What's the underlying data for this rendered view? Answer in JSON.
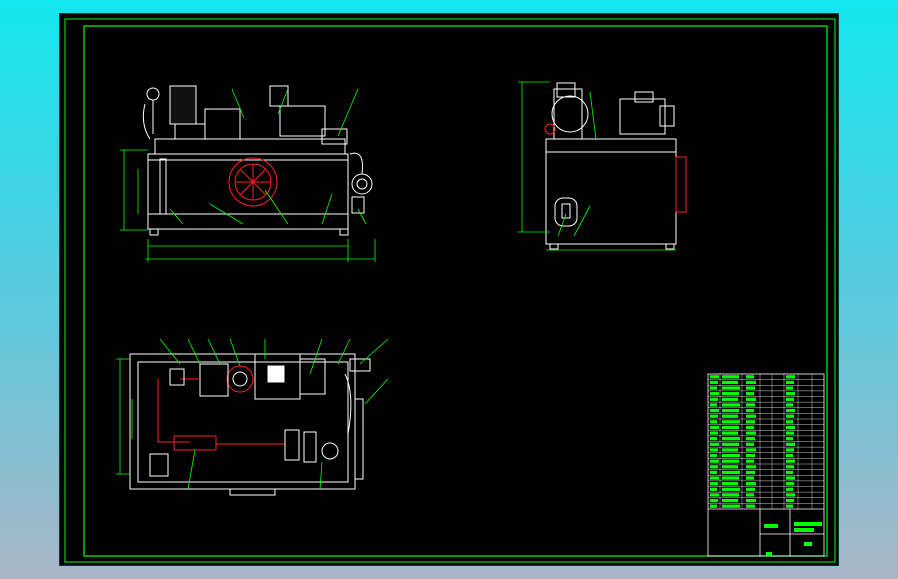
{
  "colors": {
    "outer_background": "#12e6ee",
    "sheet_background": "#000000",
    "frame": "#00ff00",
    "line": "#ffffff",
    "accent": "#ff0000",
    "leader": "#00ff00"
  },
  "views": [
    "front-view",
    "side-view",
    "top-view"
  ],
  "title_block": {
    "bom_rows": 24,
    "name_cells": 3
  }
}
